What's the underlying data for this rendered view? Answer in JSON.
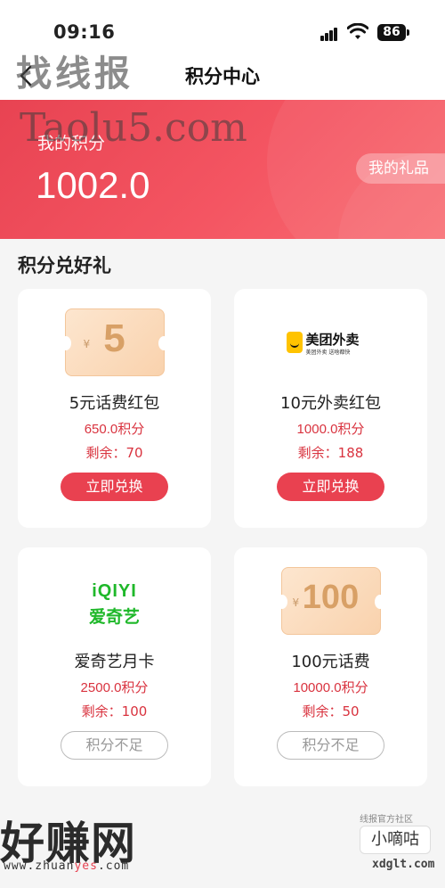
{
  "status_bar": {
    "time": "09:16",
    "battery": "86"
  },
  "nav": {
    "title": "积分中心"
  },
  "banner": {
    "label": "我的积分",
    "points": "1002.0",
    "gift_button": "我的礼品"
  },
  "section": {
    "title": "积分兑好礼"
  },
  "cards": [
    {
      "name": "5元话费红包",
      "cost": "650.0积分",
      "remaining": "剩余：70",
      "button": "立即兑换",
      "image": {
        "type": "coupon",
        "symbol": "¥",
        "value": "5"
      }
    },
    {
      "name": "10元外卖红包",
      "cost": "1000.0积分",
      "remaining": "剩余：188",
      "button": "立即兑换",
      "image": {
        "type": "meituan-logo",
        "text": "美团外卖",
        "sub": "美团外卖 送啥都快"
      }
    },
    {
      "name": "爱奇艺月卡",
      "cost": "2500.0积分",
      "remaining": "剩余：100",
      "button": "积分不足",
      "image": {
        "type": "iqiyi-logo",
        "text_en": "iQIYI",
        "text_cn": "爱奇艺"
      }
    },
    {
      "name": "100元话费",
      "cost": "10000.0积分",
      "remaining": "剩余：50",
      "button": "积分不足",
      "image": {
        "type": "coupon",
        "symbol": "¥",
        "value": "100"
      }
    }
  ],
  "watermarks": {
    "top": "找线报",
    "taolu": "Taolu5.com",
    "bottom": "好赚网",
    "url_prefix": "www.zhuan",
    "url_highlight": "yes",
    "url_suffix": ".com",
    "right_label": "线报官方社区",
    "right_box": "小嘀咕",
    "right_domain": "xdglt.com"
  },
  "colors": {
    "accent": "#e94150",
    "banner_start": "#e84352",
    "banner_end": "#f86c72",
    "iqiyi_green": "#1fb82a",
    "meituan_yellow": "#ffc300"
  }
}
